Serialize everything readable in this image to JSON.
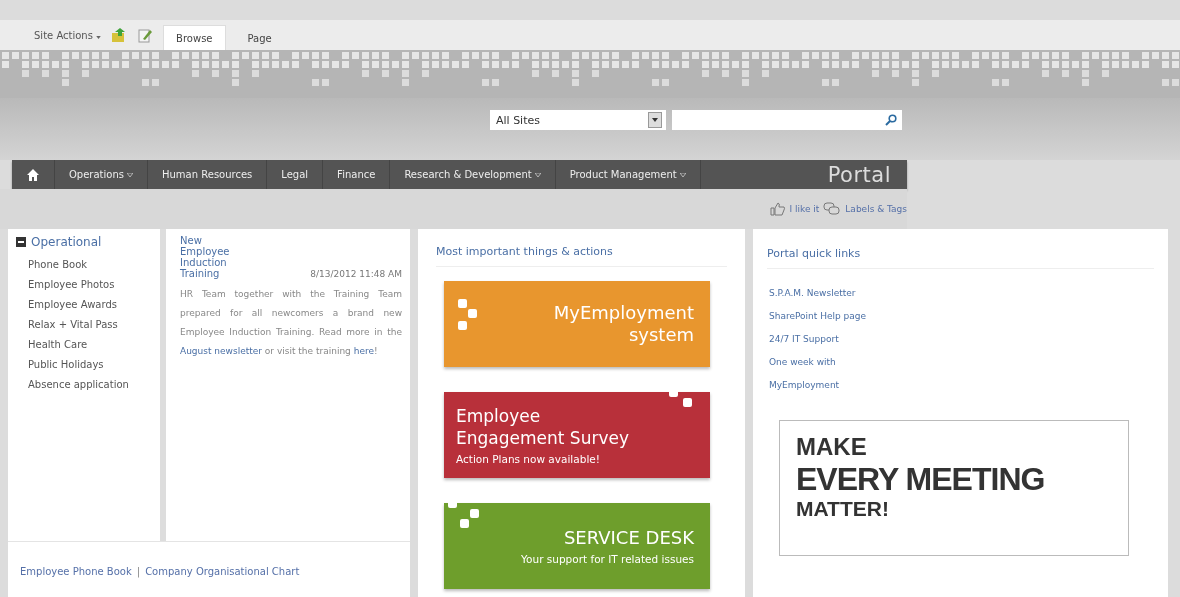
{
  "ribbon": {
    "site_actions": "Site Actions",
    "tabs": [
      {
        "label": "Browse",
        "selected": true
      },
      {
        "label": "Page",
        "selected": false
      }
    ]
  },
  "search": {
    "scope": "All Sites"
  },
  "nav": {
    "items": [
      {
        "label": "Operations",
        "has_menu": true
      },
      {
        "label": "Human Resources",
        "has_menu": false
      },
      {
        "label": "Legal",
        "has_menu": false
      },
      {
        "label": "Finance",
        "has_menu": false
      },
      {
        "label": "Research & Development",
        "has_menu": true
      },
      {
        "label": "Product Management",
        "has_menu": true
      }
    ],
    "brand": "Portal"
  },
  "social": {
    "like": "I like it",
    "tags": "Labels & Tags"
  },
  "sidebar": {
    "heading": "Operational",
    "expanded": true,
    "items": [
      "Phone Book",
      "Employee Photos",
      "Employee Awards",
      "Relax + Vital Pass",
      "Health Care",
      "Public Holidays",
      "Absence application"
    ]
  },
  "news": {
    "title": "New Employee Induction Training",
    "date": "8/13/2012 11:48 AM",
    "body": [
      {
        "kind": "text",
        "text": "HR Team together with the Training Team prepared for all newcomers a brand new Employee Induction Training. Read more in the "
      },
      {
        "kind": "link",
        "text": "August newsletter"
      },
      {
        "kind": "text",
        "text": " or visit the training "
      },
      {
        "kind": "link",
        "text": "here"
      },
      {
        "kind": "text",
        "text": "!"
      }
    ]
  },
  "footer_links": [
    {
      "kind": "link",
      "text": "Employee Phone Book"
    },
    {
      "kind": "separator",
      "text": "|"
    },
    {
      "kind": "link",
      "text": "Company Organisational Chart"
    }
  ],
  "actions": {
    "heading": "Most important things & actions",
    "tiles": [
      {
        "title": "MyEmployment system",
        "color": "#e8962e"
      },
      {
        "title": "Employee Engagement Survey",
        "subtitle": "Action Plans now available!",
        "color": "#b8303a"
      },
      {
        "title": "SERVICE DESK",
        "subtitle": "Your support for IT related issues",
        "color": "#6e9e2c"
      }
    ]
  },
  "quick_links": {
    "heading": "Portal quick links",
    "items": [
      "S.P.A.M. Newsletter",
      "SharePoint Help page",
      "24/7 IT Support",
      "One week with",
      "MyEmployment"
    ]
  },
  "poster": {
    "lines": [
      "MAKE",
      "EVERY MEETING",
      "MATTER!"
    ]
  }
}
